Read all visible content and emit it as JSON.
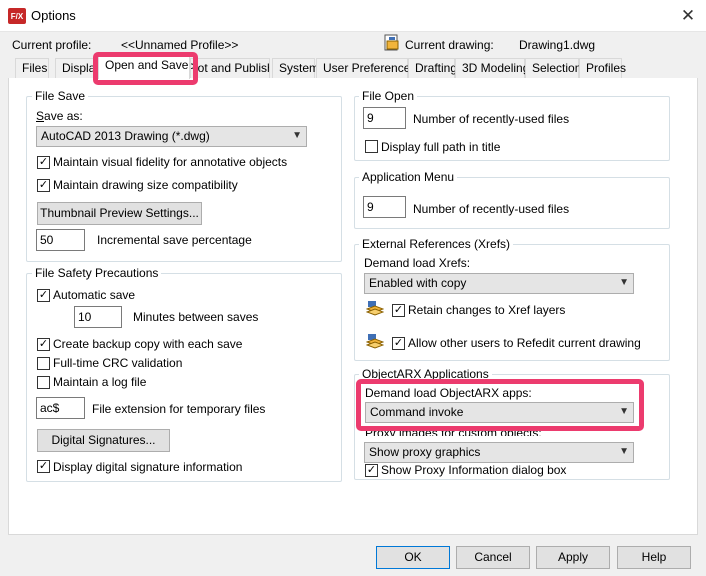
{
  "window": {
    "app_icon_text": "F/X",
    "title": "Options",
    "close_glyph": "✕"
  },
  "profile_bar": {
    "current_profile_label": "Current profile:",
    "current_profile_value": "<<Unnamed Profile>>",
    "current_drawing_label": "Current drawing:",
    "current_drawing_value": "Drawing1.dwg"
  },
  "tabs": [
    {
      "label": "Files"
    },
    {
      "label": "Display"
    },
    {
      "label": "Open and Save",
      "active": true
    },
    {
      "label": "Plot and Publish"
    },
    {
      "label": "System"
    },
    {
      "label": "User Preferences"
    },
    {
      "label": "Drafting"
    },
    {
      "label": "3D Modeling"
    },
    {
      "label": "Selection"
    },
    {
      "label": "Profiles"
    }
  ],
  "file_save": {
    "title": "File Save",
    "save_as_label": "Save as:",
    "save_as_value": "AutoCAD 2013 Drawing (*.dwg)",
    "maintain_fidelity": {
      "label": "Maintain visual fidelity for annotative objects",
      "checked": true
    },
    "maintain_size": {
      "label": "Maintain drawing size compatibility",
      "checked": true
    },
    "thumbnail_button": "Thumbnail Preview Settings...",
    "incremental_value": "50",
    "incremental_label": "Incremental save percentage"
  },
  "file_safety": {
    "title": "File Safety Precautions",
    "automatic_save": {
      "label": "Automatic save",
      "checked": true
    },
    "minutes_value": "10",
    "minutes_label": "Minutes between saves",
    "backup_copy": {
      "label": "Create backup copy with each save",
      "checked": true
    },
    "crc_validation": {
      "label": "Full-time CRC validation",
      "checked": false
    },
    "log_file": {
      "label": "Maintain a log file",
      "checked": false
    },
    "temp_ext_value": "ac$",
    "temp_ext_label": "File extension for temporary files",
    "digital_sig_button": "Digital Signatures...",
    "display_sig": {
      "label": "Display digital signature information",
      "checked": true
    }
  },
  "file_open": {
    "title": "File Open",
    "recent_value": "9",
    "recent_label": "Number of recently-used files",
    "full_path": {
      "label": "Display full path in title",
      "checked": false
    }
  },
  "app_menu": {
    "title": "Application Menu",
    "recent_value": "9",
    "recent_label": "Number of recently-used files"
  },
  "xrefs": {
    "title": "External References (Xrefs)",
    "demand_label": "Demand load Xrefs:",
    "demand_value": "Enabled with copy",
    "retain_changes": {
      "label": "Retain changes to Xref layers",
      "checked": true
    },
    "allow_refedit": {
      "label": "Allow other users to Refedit current drawing",
      "checked": true
    }
  },
  "objectarx": {
    "title": "ObjectARX Applications",
    "demand_label": "Demand load ObjectARX apps:",
    "demand_value": "Command invoke",
    "proxy_label": "Proxy images for custom objects:",
    "proxy_value": "Show proxy graphics",
    "show_proxy_info": {
      "label": "Show Proxy Information dialog box",
      "checked": true
    }
  },
  "footer": {
    "ok": "OK",
    "cancel": "Cancel",
    "apply": "Apply",
    "help": "Help"
  },
  "colors": {
    "highlight": "#ec3b6e",
    "default_button_border": "#0078d7"
  },
  "icons": {
    "close": "close-icon",
    "drawing": "drawing-file-icon",
    "xref": "xref-layer-icon",
    "chevron": "chevron-down-icon"
  }
}
